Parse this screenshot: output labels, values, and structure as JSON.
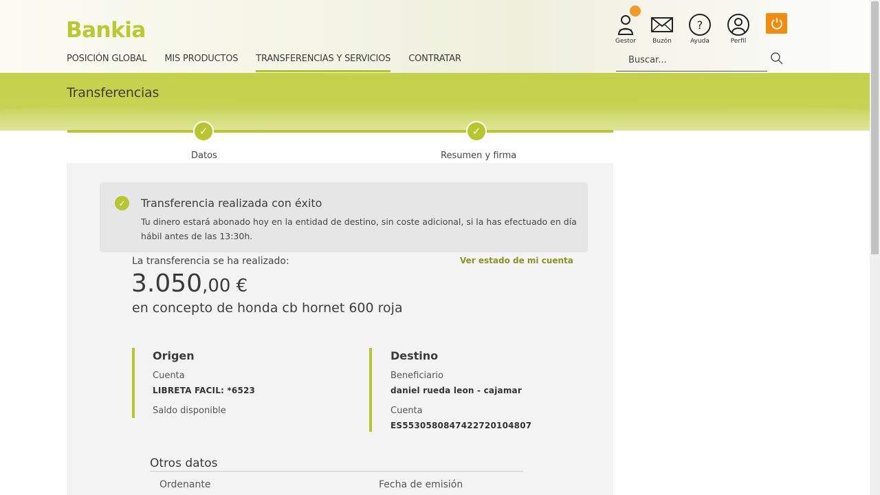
{
  "header": {
    "logo": "Bankia",
    "nav": [
      {
        "label": "POSICIÓN GLOBAL"
      },
      {
        "label": "MIS PRODUCTOS"
      },
      {
        "label": "TRANSFERENCIAS Y SERVICIOS",
        "active": true
      },
      {
        "label": "CONTRATAR"
      }
    ],
    "tools": {
      "gestor": "Gestor",
      "buzon": "Buzón",
      "ayuda": "Ayuda",
      "perfil": "Perfil"
    },
    "search_placeholder": "Buscar...",
    "accent_color": "#b7c52e",
    "power_color": "#f28c0f"
  },
  "page": {
    "title": "Transferencias"
  },
  "stepper": {
    "steps": [
      {
        "label": "Datos",
        "done": true
      },
      {
        "label": "Resumen y firma",
        "done": true
      }
    ]
  },
  "success": {
    "title": "Transferencia realizada con éxito",
    "text": "Tu dinero estará abonado hoy en la entidad de destino, sin coste adicional, si la has efectuado en día hábil antes de las 13:30h."
  },
  "summary": {
    "done_label": "La transferencia se ha realizado:",
    "see_account": "Ver estado de mi cuenta",
    "amount_int": "3.050",
    "amount_dec": ",00 €",
    "concept": "en concepto de honda cb hornet 600 roja"
  },
  "origin": {
    "title": "Origen",
    "account_label": "Cuenta",
    "account_value": "LIBRETA FACIL: *6523",
    "balance_label": "Saldo disponible"
  },
  "destination": {
    "title": "Destino",
    "beneficiary_label": "Beneficiario",
    "beneficiary_value": "daniel rueda leon - cajamar",
    "account_label": "Cuenta",
    "account_value": "ES5530580847422720104807"
  },
  "other": {
    "title": "Otros datos",
    "ordering_label": "Ordenante",
    "date_label": "Fecha de emisión"
  }
}
